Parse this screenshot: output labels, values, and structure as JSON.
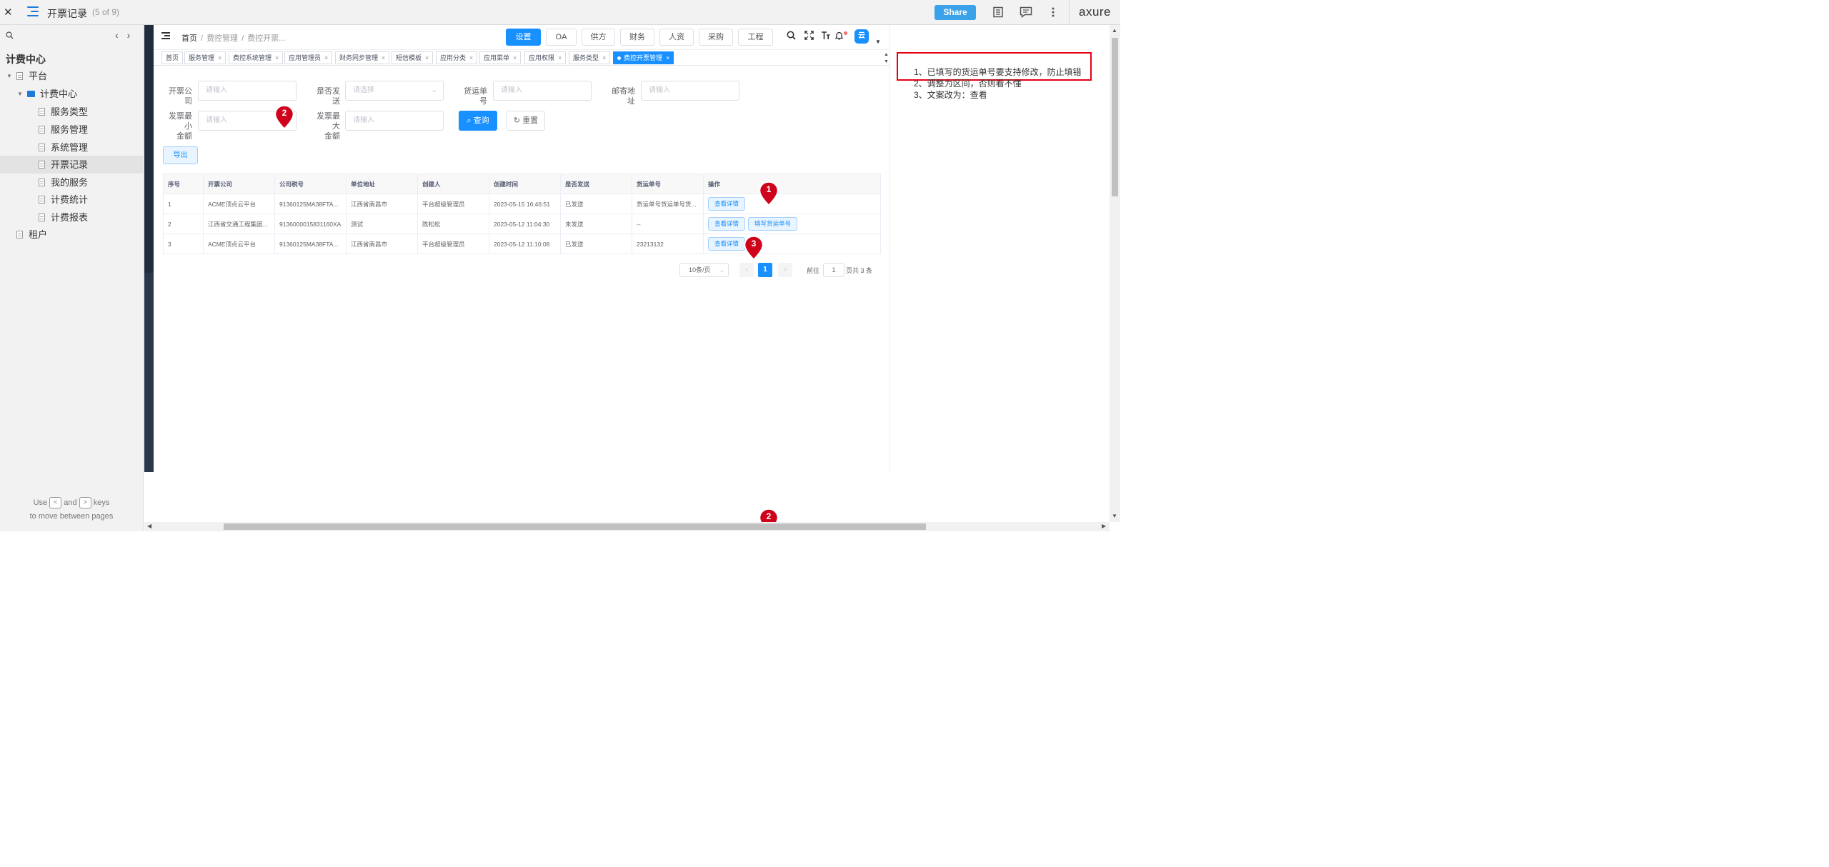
{
  "viewer": {
    "close": "✕",
    "page_title": "开票记录",
    "page_count": "(5 of 9)",
    "share": "Share",
    "brand": "axure"
  },
  "sidebar": {
    "heading": "计费中心",
    "items": [
      {
        "label": "平台",
        "kind": "doc",
        "expanded": true
      },
      {
        "label": "计费中心",
        "kind": "folder",
        "expanded": true
      },
      {
        "label": "服务类型",
        "kind": "doc"
      },
      {
        "label": "服务管理",
        "kind": "doc"
      },
      {
        "label": "系统管理",
        "kind": "doc"
      },
      {
        "label": "开票记录",
        "kind": "doc",
        "selected": true
      },
      {
        "label": "我的服务",
        "kind": "doc"
      },
      {
        "label": "计费统计",
        "kind": "doc"
      },
      {
        "label": "计费报表",
        "kind": "doc"
      },
      {
        "label": "租户",
        "kind": "doc"
      }
    ],
    "hint_use": "Use",
    "hint_and": "and",
    "hint_keys": "keys",
    "hint_line2": "to move between pages",
    "key_prev": "<",
    "key_next": ">"
  },
  "app": {
    "breadcrumb": [
      "首页",
      "费控管理",
      "费控开票..."
    ],
    "nav": [
      "设置",
      "OA",
      "供方",
      "财务",
      "人资",
      "采购",
      "工程"
    ],
    "active_nav": "设置",
    "avatar_text": "云",
    "tags": [
      {
        "label": "首页",
        "closable": false
      },
      {
        "label": "服务管理",
        "closable": true
      },
      {
        "label": "费控系统管理",
        "closable": true
      },
      {
        "label": "应用管理员",
        "closable": true
      },
      {
        "label": "财务同步管理",
        "closable": true
      },
      {
        "label": "短信模板",
        "closable": true
      },
      {
        "label": "应用分类",
        "closable": true
      },
      {
        "label": "应用菜单",
        "closable": true
      },
      {
        "label": "应用权限",
        "closable": true
      },
      {
        "label": "服务类型",
        "closable": true
      },
      {
        "label": "费控开票管理",
        "closable": true,
        "active": true
      }
    ],
    "filters": {
      "company_label": "开票公司",
      "company_placeholder": "请输入",
      "sent_label": "是否发送",
      "sent_placeholder": "请选择",
      "tracking_label": "货运单号",
      "tracking_placeholder": "请输入",
      "address_label": "邮寄地址",
      "address_placeholder": "请输入",
      "min_label_1": "发票最小",
      "min_label_2": "金额",
      "min_placeholder": "请输入",
      "max_label_1": "发票最大",
      "max_label_2": "金额",
      "max_placeholder": "请输入",
      "query": "查询",
      "reset": "重置"
    },
    "export": "导出",
    "table": {
      "columns": [
        "序号",
        "开票公司",
        "公司税号",
        "单位地址",
        "创建人",
        "创建时间",
        "是否发送",
        "货运单号",
        "操作"
      ],
      "rows": [
        {
          "no": "1",
          "company": "ACME顶点云平台",
          "tax": "91360125MA38FTA...",
          "address": "江西省南昌市",
          "creator": "平台超级管理员",
          "time": "2023-05-15 16:46:51",
          "sent": "已发送",
          "tracking": "货运单号货运单号货...",
          "actions": [
            "查看详情"
          ]
        },
        {
          "no": "2",
          "company": "江西省交通工程集团...",
          "tax": "9136000015831160XA",
          "address": "测试",
          "creator": "陈松松",
          "time": "2023-05-12 11:04:30",
          "sent": "未发送",
          "tracking": "--",
          "actions": [
            "查看详情",
            "填写货运单号"
          ]
        },
        {
          "no": "3",
          "company": "ACME顶点云平台",
          "tax": "91360125MA38FTA...",
          "address": "江西省南昌市",
          "creator": "平台超级管理员",
          "time": "2023-05-12 11:10:08",
          "sent": "已发送",
          "tracking": "23213132",
          "actions": [
            "查看详情"
          ]
        }
      ]
    },
    "pager": {
      "size": "10条/页",
      "current": "1",
      "goto": "前往",
      "goto_value": "1",
      "total": "页共 3 条"
    }
  },
  "markers": [
    "1",
    "2",
    "3",
    "2"
  ],
  "notes": {
    "lines": [
      "1、已填写的货运单号要支持修改，防止填错",
      "2、调整为区间，否则看不懂",
      "3、文案改为：查看"
    ]
  },
  "colors": {
    "primary": "#1890ff",
    "marker": "#d0021b",
    "note_box": "#e60012",
    "share": "#3ba1e8"
  }
}
